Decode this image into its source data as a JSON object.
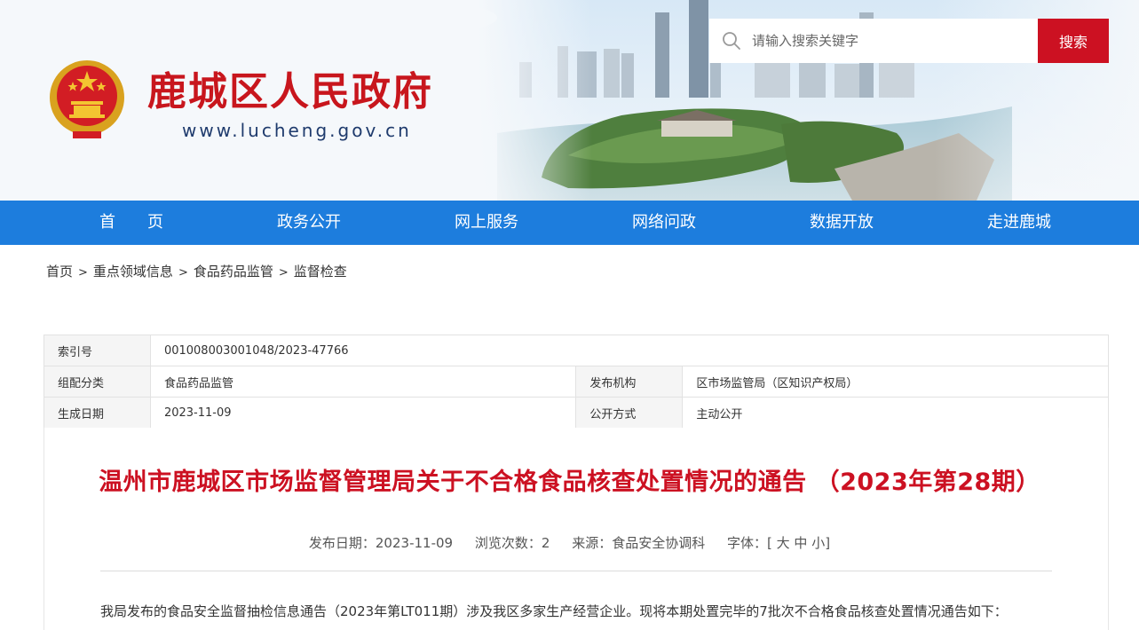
{
  "header": {
    "site_title": "鹿城区人民政府",
    "site_url": "www.lucheng.gov.cn",
    "search": {
      "placeholder": "请输入搜索关键字",
      "button_label": "搜索"
    },
    "colors": {
      "brand_red": "#c8161d",
      "button_red": "#cc1122",
      "url_navy": "#1f3b6d"
    }
  },
  "nav": {
    "color": "#1d7ddd",
    "items": [
      {
        "label": "首　　页"
      },
      {
        "label": "政务公开"
      },
      {
        "label": "网上服务"
      },
      {
        "label": "网络问政"
      },
      {
        "label": "数据开放"
      },
      {
        "label": "走进鹿城"
      }
    ]
  },
  "breadcrumb": {
    "items": [
      "首页",
      "重点领域信息",
      "食品药品监管",
      "监督检查"
    ],
    "separator": ">"
  },
  "meta": {
    "index_label": "索引号",
    "index_value": "001008003001048/2023-47766",
    "category_label": "组配分类",
    "category_value": "食品药品监管",
    "publisher_label": "发布机构",
    "publisher_value": "区市场监管局（区知识产权局）",
    "created_label": "生成日期",
    "created_value": "2023-11-09",
    "disclosure_label": "公开方式",
    "disclosure_value": "主动公开"
  },
  "article": {
    "title": "温州市鹿城区市场监督管理局关于不合格食品核查处置情况的通告 （2023年第28期）",
    "publish_date": "发布日期：2023-11-09",
    "views": "浏览次数：2",
    "source": "来源：食品安全协调科",
    "font_size_label": "字体：[",
    "font_large": "大",
    "font_medium": "中",
    "font_small": "小",
    "font_size_end": "]",
    "body_first_line": "我局发布的食品安全监督抽检信息通告（2023年第LT011期）涉及我区多家生产经营企业。现将本期处置完毕的7批次不合格食品核查处置情况通告如下："
  }
}
